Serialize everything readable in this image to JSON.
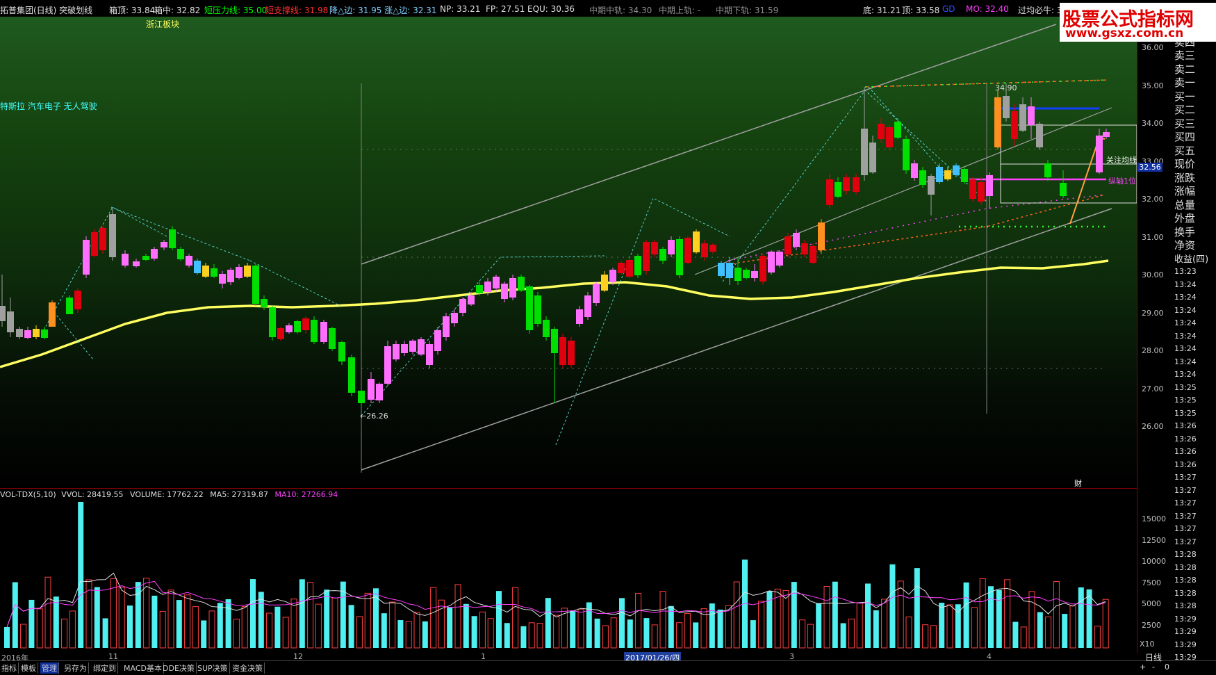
{
  "title_bar": {
    "stock_name": "拓普集团(日线) 突破划线",
    "items": [
      {
        "text": "箱顶: 33.84",
        "color": "#e0e0e0"
      },
      {
        "text": "箱中: 32.82",
        "color": "#e0e0e0"
      },
      {
        "text": "短压力线: 35.00",
        "color": "#00ff00"
      },
      {
        "text": "短支撑线: 31.98",
        "color": "#ff3030"
      },
      {
        "text": "降△边: 31.95",
        "color": "#80d0ff"
      },
      {
        "text": "涨△边: 32.31",
        "color": "#80d0ff"
      },
      {
        "text": "NP: 33.21",
        "color": "#e0e0e0"
      },
      {
        "text": "FP: 27.51",
        "color": "#e0e0e0"
      },
      {
        "text": "EQU: 30.36",
        "color": "#e0e0e0"
      },
      {
        "text": "中期中轨: 34.30",
        "color": "#909090"
      },
      {
        "text": "中期上轨: -",
        "color": "#909090"
      },
      {
        "text": "中期下轨: 31.59",
        "color": "#909090"
      },
      {
        "text": "底: 31.21",
        "color": "#e0e0e0"
      },
      {
        "text": "顶: 33.58",
        "color": "#e0e0e0"
      },
      {
        "text": "GD",
        "color": "#3050ff"
      },
      {
        "text": "MO: 32.40",
        "color": "#ff40ff"
      },
      {
        "text": "过均必牛: 3",
        "color": "#e0e0e0"
      }
    ]
  },
  "watermark": {
    "line1": "股票公式指标网",
    "line2": "www.gsxz.com.cn"
  },
  "annotations": {
    "sector": "浙江板块",
    "concepts": "特斯拉 汽车电子 无人驾驶",
    "low_label": "←26.26",
    "high_label": "34.90",
    "focus_label": "关注均线",
    "axis_label": "纵轴1位",
    "cai": "财",
    "price_tag": "32.56"
  },
  "price_axis": [
    "36.00",
    "35.00",
    "34.00",
    "33.00",
    "32.00",
    "31.00",
    "30.00",
    "29.00",
    "28.00",
    "27.00",
    "26.00"
  ],
  "volume_axis": [
    "15000",
    "12500",
    "10000",
    "7500",
    "5000",
    "2500"
  ],
  "volume_axis_unit": "X10",
  "order_book": [
    "卖五",
    "卖四",
    "卖三",
    "卖二",
    "卖一",
    "买一",
    "买二",
    "买三",
    "买四",
    "买五",
    "现价",
    "涨跌",
    "涨幅",
    "总量",
    "外盘",
    "换手",
    "净资",
    "收益(四)"
  ],
  "time_list": [
    "13:23",
    "13:24",
    "13:24",
    "13:24",
    "13:24",
    "13:24",
    "13:24",
    "13:24",
    "13:24",
    "13:25",
    "13:25",
    "13:25",
    "13:26",
    "13:26",
    "13:26",
    "13:26",
    "13:27",
    "13:27",
    "13:27",
    "13:27",
    "13:27",
    "13:27",
    "13:28",
    "13:28",
    "13:28",
    "13:28",
    "13:28",
    "13:29",
    "13:29",
    "13:29",
    "13:29",
    "13:29"
  ],
  "volume_header": {
    "name": "VOL-TDX(5,10)",
    "vvol": "VVOL: 28419.55",
    "volume": "VOLUME: 17762.22",
    "ma5": "MA5: 27319.87",
    "ma10": "MA10: 27266.94"
  },
  "date_axis": [
    "2016年",
    "11",
    "12",
    "1",
    "2017/01/26/四",
    "3",
    "4"
  ],
  "bottom_tabs": [
    "指标",
    "模板",
    "管理",
    "另存为",
    "绑定到",
    "MACD基本",
    "DDE决策",
    "SUP决策",
    "资金决策"
  ],
  "bottom_right": {
    "period": "日线",
    "buttons": [
      "+",
      "-",
      "0"
    ]
  },
  "colors": {
    "up": "#ff6eff",
    "down": "#00ff00",
    "yellow_ma": "#ffff60",
    "channel": "#a0a0a0"
  }
}
